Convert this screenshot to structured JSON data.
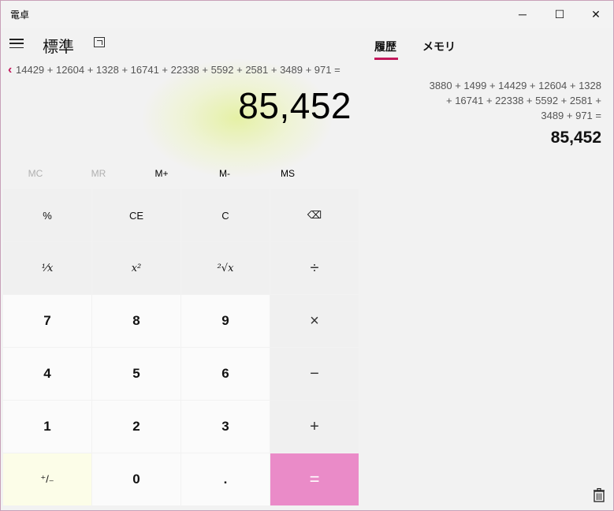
{
  "window": {
    "title": "電卓",
    "controls": {
      "minimize": "─",
      "maximize": "☐",
      "close": "✕"
    }
  },
  "calculator": {
    "mode": "標準",
    "expression": "14429 + 12604 + 1328 + 16741 + 22338 + 5592 + 2581 + 3489 + 971 =",
    "result": "85,452",
    "memory": [
      "MC",
      "MR",
      "M+",
      "M-",
      "MS"
    ],
    "keys": {
      "percent": "%",
      "ce": "CE",
      "c": "C",
      "backspace": "⌫",
      "reciprocal": "¹⁄x",
      "square": "x²",
      "sqrt": "²√x",
      "divide": "÷",
      "seven": "7",
      "eight": "8",
      "nine": "9",
      "multiply": "×",
      "four": "4",
      "five": "5",
      "six": "6",
      "minus": "−",
      "one": "1",
      "two": "2",
      "three": "3",
      "plus": "+",
      "negate": "⁺/₋",
      "zero": "0",
      "decimal": ".",
      "equals": "="
    }
  },
  "history": {
    "tabs": [
      "履歴",
      "メモリ"
    ],
    "entries": [
      {
        "expression_lines": [
          "3880 + 1499 + 14429 + 12604 + 1328",
          "+ 16741 + 22338 + 5592 + 2581 +",
          "3489 + 971 ="
        ],
        "result": "85,452"
      }
    ]
  },
  "colors": {
    "accent": "#c2185b",
    "equals_bg": "#ea8bc8"
  }
}
